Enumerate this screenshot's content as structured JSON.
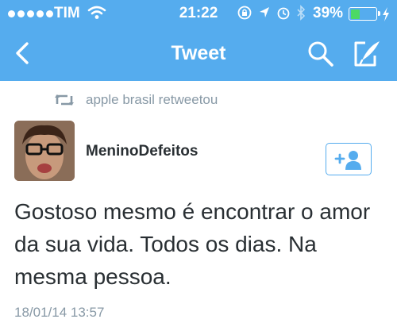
{
  "status_bar": {
    "carrier": "TIM",
    "time": "21:22",
    "battery_percent": "39%",
    "battery_level": 0.39,
    "signal_dots": 5,
    "icons": [
      "wifi-icon",
      "rotation-lock-icon",
      "location-icon",
      "alarm-icon",
      "bluetooth-icon",
      "battery-icon",
      "charging-icon"
    ]
  },
  "nav": {
    "back_icon": "chevron-left-icon",
    "title": "Tweet",
    "search_icon": "search-icon",
    "compose_icon": "compose-icon"
  },
  "tweet": {
    "retweet_icon": "retweet-icon",
    "retweeted_by": "apple brasil retweetou",
    "username": "MeninoDefeitos",
    "follow_icon": "add-follow-icon",
    "text": "Gostoso mesmo é encontrar o amor da sua vida. Todos os dias. Na mesma pessoa.",
    "timestamp": "18/01/14 13:57"
  },
  "colors": {
    "brand": "#55acee",
    "text": "#292f33",
    "muted": "#8899a6",
    "battery_fill": "#4cd964"
  }
}
